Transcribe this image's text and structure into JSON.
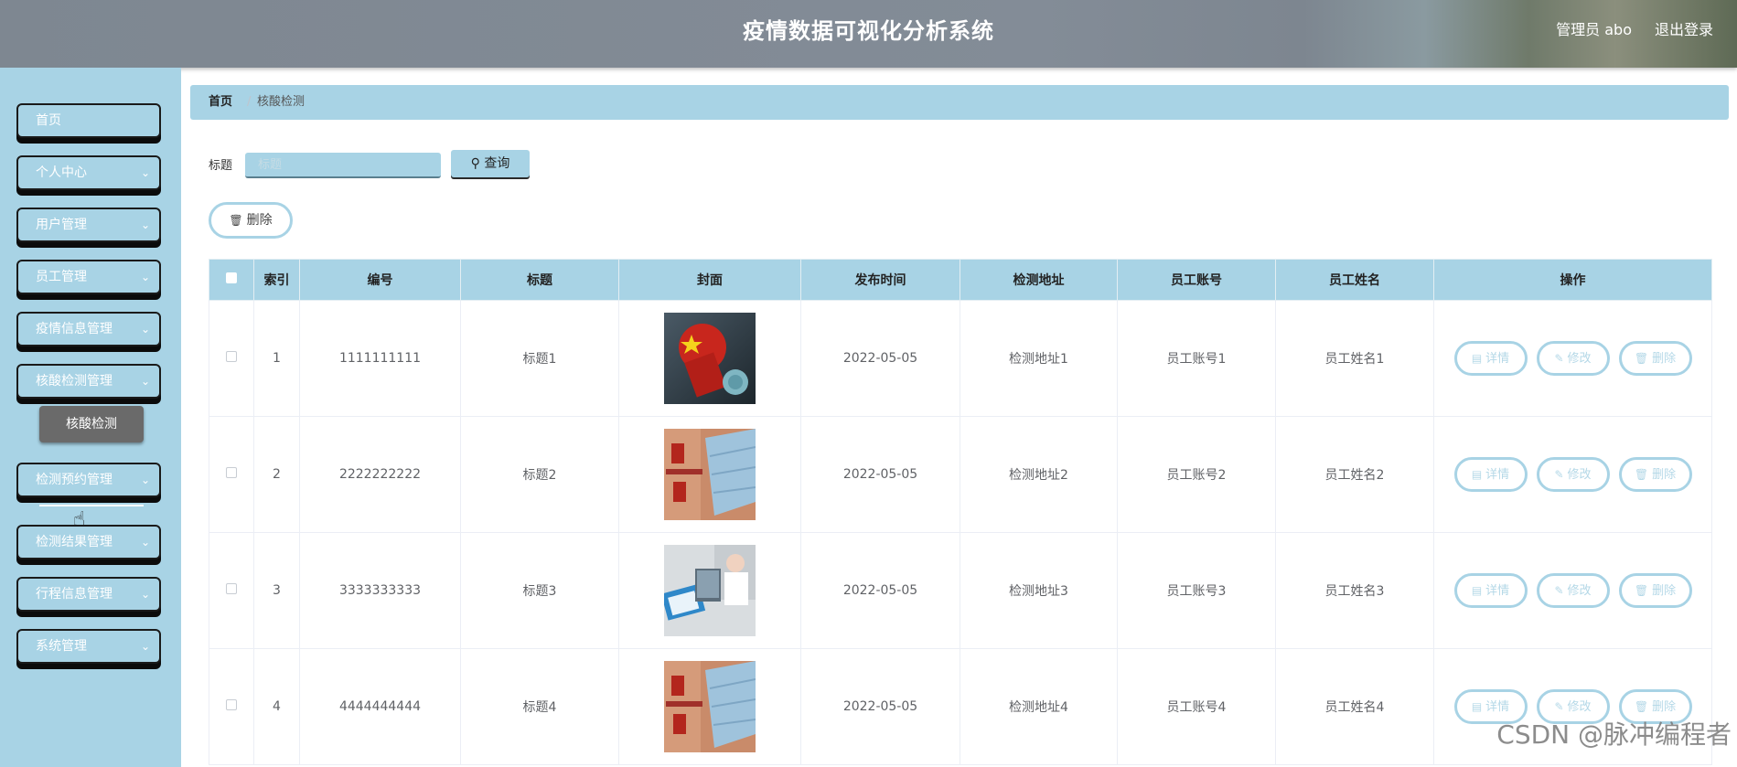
{
  "header": {
    "title": "疫情数据可视化分析系统",
    "user_label": "管理员 abo",
    "logout_label": "退出登录"
  },
  "sidebar": {
    "items": [
      {
        "label": "首页",
        "has_arrow": false
      },
      {
        "label": "个人中心",
        "has_arrow": true
      },
      {
        "label": "用户管理",
        "has_arrow": true
      },
      {
        "label": "员工管理",
        "has_arrow": true
      },
      {
        "label": "疫情信息管理",
        "has_arrow": true
      },
      {
        "label": "核酸检测管理",
        "has_arrow": true
      },
      {
        "label": "检测预约管理",
        "has_arrow": true
      },
      {
        "label": "检测结果管理",
        "has_arrow": true
      },
      {
        "label": "行程信息管理",
        "has_arrow": true
      },
      {
        "label": "系统管理",
        "has_arrow": true
      }
    ],
    "active_sub": "核酸检测"
  },
  "breadcrumb": {
    "home": "首页",
    "separator": "/",
    "current": "核酸检测"
  },
  "search": {
    "label": "标题",
    "placeholder": "标题",
    "value": "",
    "button_label": "查询"
  },
  "actions": {
    "delete_label": "删除"
  },
  "table": {
    "headers": [
      "索引",
      "编号",
      "标题",
      "封面",
      "发布时间",
      "检测地址",
      "员工账号",
      "员工姓名",
      "操作"
    ],
    "rows": [
      {
        "index": "1",
        "code": "1111111111",
        "title": "标题1",
        "cover": "fist-virus-poster",
        "time": "2022-05-05",
        "address": "检测地址1",
        "account": "员工账号1",
        "name": "员工姓名1"
      },
      {
        "index": "2",
        "code": "2222222222",
        "title": "标题2",
        "cover": "mask-poster",
        "time": "2022-05-05",
        "address": "检测地址2",
        "account": "员工账号2",
        "name": "员工姓名2"
      },
      {
        "index": "3",
        "code": "3333333333",
        "title": "标题3",
        "cover": "doctor-laptop-photo",
        "time": "2022-05-05",
        "address": "检测地址3",
        "account": "员工账号3",
        "name": "员工姓名3"
      },
      {
        "index": "4",
        "code": "4444444444",
        "title": "标题4",
        "cover": "mask-poster",
        "time": "2022-05-05",
        "address": "检测地址4",
        "account": "员工账号4",
        "name": "员工姓名4"
      }
    ],
    "row_actions": {
      "detail": "详情",
      "edit": "修改",
      "delete": "删除"
    }
  },
  "watermark": "CSDN @脉冲编程者",
  "colors": {
    "accent": "#a8d3e5",
    "sub_active": "#6a6a6a",
    "button_outline": "#a8d3e5"
  }
}
